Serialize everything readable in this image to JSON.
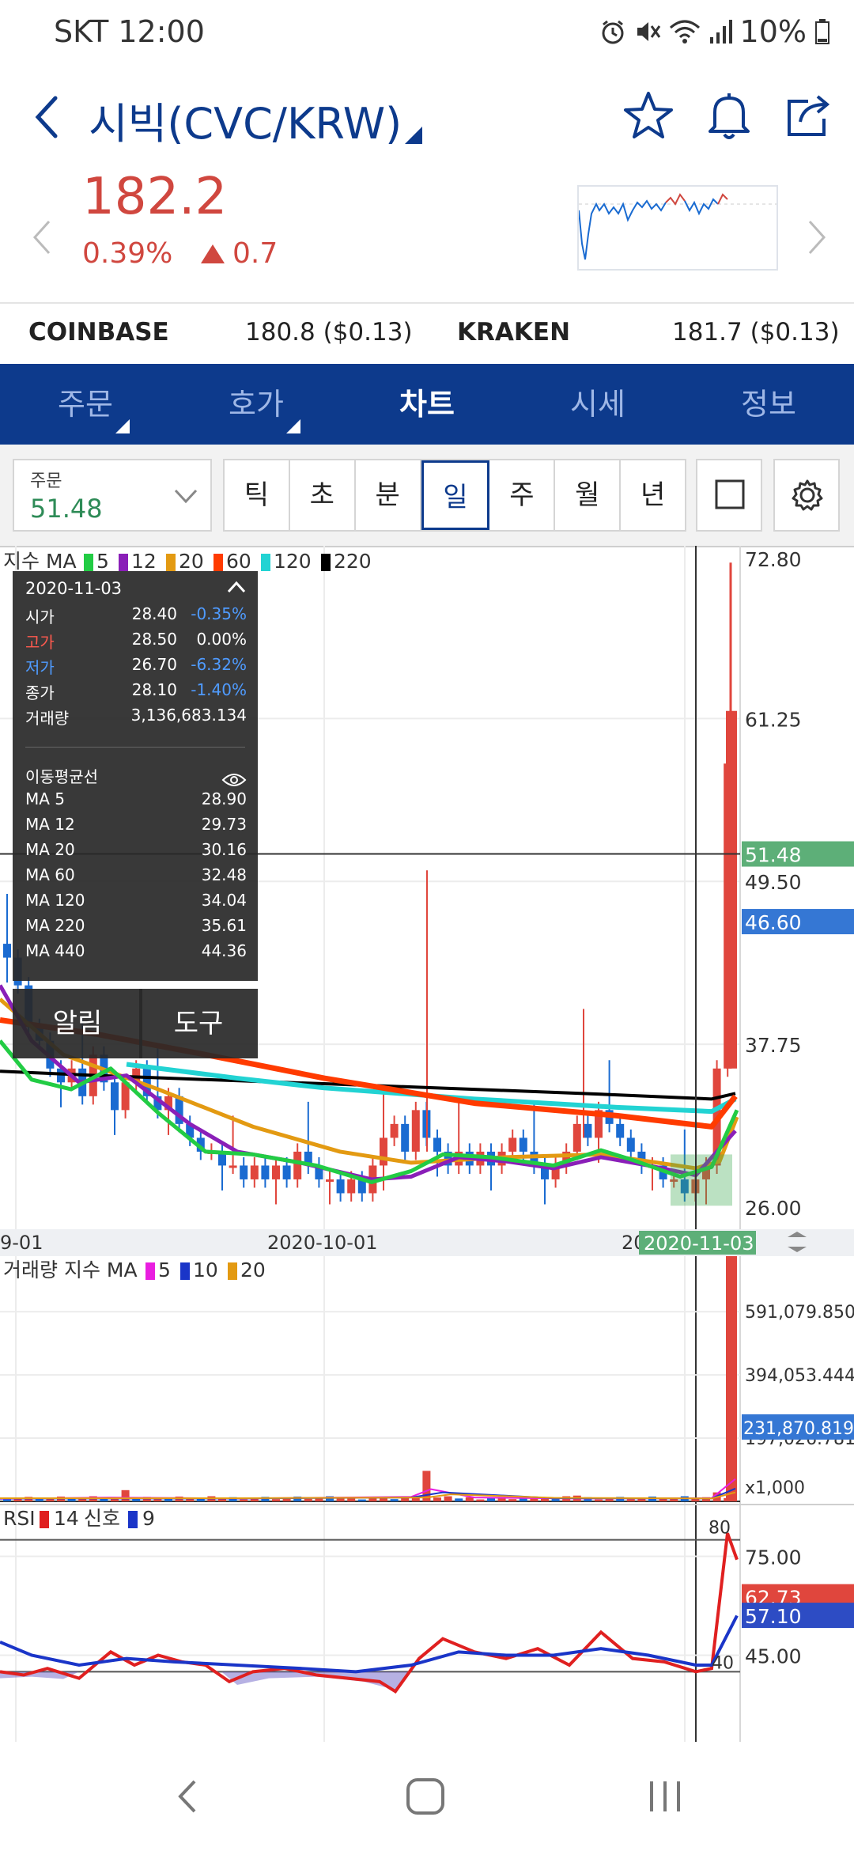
{
  "status": {
    "carrier_time": "SKT 12:00",
    "battery": "10%"
  },
  "header": {
    "title": "시빅(CVC/KRW)"
  },
  "price": {
    "current": "182.2",
    "change_rate": "0.39%",
    "change_abs": "0.7"
  },
  "exchanges": [
    {
      "name": "COINBASE",
      "value": "180.8 ($0.13)"
    },
    {
      "name": "KRAKEN",
      "value": "181.7 ($0.13)"
    }
  ],
  "tabs": [
    {
      "label": "주문",
      "has_menu": true
    },
    {
      "label": "호가",
      "has_menu": true
    },
    {
      "label": "차트",
      "active": true
    },
    {
      "label": "시세"
    },
    {
      "label": "정보"
    }
  ],
  "toolbar": {
    "order_label": "주문",
    "order_value": "51.48",
    "periods": [
      "틱",
      "초",
      "분",
      "일",
      "주",
      "월",
      "년"
    ],
    "active_period": "일"
  },
  "main_chart": {
    "legend_prefix": "지수 MA",
    "ma_legend": [
      {
        "label": "5",
        "color": "#22cc44"
      },
      {
        "label": "12",
        "color": "#8a1fb8"
      },
      {
        "label": "20",
        "color": "#e39a12"
      },
      {
        "label": "60",
        "color": "#ff3b00"
      },
      {
        "label": "120",
        "color": "#22d3d3"
      },
      {
        "label": "220",
        "color": "#000000"
      }
    ],
    "y_labels": [
      "72.80",
      "61.25",
      "49.50",
      "37.75",
      "26.00"
    ],
    "crosshair_price": "51.48",
    "last_price_badge": "46.60",
    "x_labels": [
      "9-01",
      "2020-10-01",
      "20"
    ],
    "crosshair_date": "2020-11-03"
  },
  "tooltip": {
    "date": "2020-11-03",
    "rows": [
      {
        "label": "시가",
        "value": "28.40",
        "pct": "-0.35%",
        "label_color": "#ffffff",
        "pct_color": "#4f9bff"
      },
      {
        "label": "고가",
        "value": "28.50",
        "pct": "0.00%",
        "label_color": "#ff5a4f",
        "pct_color": "#ffffff"
      },
      {
        "label": "저가",
        "value": "26.70",
        "pct": "-6.32%",
        "label_color": "#4f9bff",
        "pct_color": "#4f9bff"
      },
      {
        "label": "종가",
        "value": "28.10",
        "pct": "-1.40%",
        "label_color": "#ffffff",
        "pct_color": "#4f9bff"
      },
      {
        "label": "거래량",
        "value": "3,136,683.134",
        "pct": "",
        "label_color": "#ffffff",
        "pct_color": "#ffffff"
      }
    ],
    "ma_title": "이동평균선",
    "ma_rows": [
      {
        "label": "MA 5",
        "value": "28.90"
      },
      {
        "label": "MA 12",
        "value": "29.73"
      },
      {
        "label": "MA 20",
        "value": "30.16"
      },
      {
        "label": "MA 60",
        "value": "32.48"
      },
      {
        "label": "MA 120",
        "value": "34.04"
      },
      {
        "label": "MA 220",
        "value": "35.61"
      },
      {
        "label": "MA 440",
        "value": "44.36"
      }
    ]
  },
  "buttons": {
    "alert": "알림",
    "tools": "도구"
  },
  "volume_chart": {
    "legend_prefix": "거래량 지수 MA",
    "ma_legend": [
      {
        "label": "5",
        "color": "#e91ee0"
      },
      {
        "label": "10",
        "color": "#1a35c8"
      },
      {
        "label": "20",
        "color": "#e39a12"
      }
    ],
    "y_labels": [
      "591,079.850",
      "394,053.444",
      "197,026.781",
      "x1,000"
    ],
    "badge": "231,870.819"
  },
  "rsi_chart": {
    "legend_prefix": "RSI",
    "rsi_label": "14",
    "rsi_color": "#e02020",
    "signal_prefix": "신호",
    "signal_label": "9",
    "signal_color": "#1a35c8",
    "level_high": "80",
    "level_low": "40",
    "y_labels": [
      "75.00",
      "45.00"
    ],
    "rsi_badge": "62.73",
    "signal_badge": "57.10"
  }
}
